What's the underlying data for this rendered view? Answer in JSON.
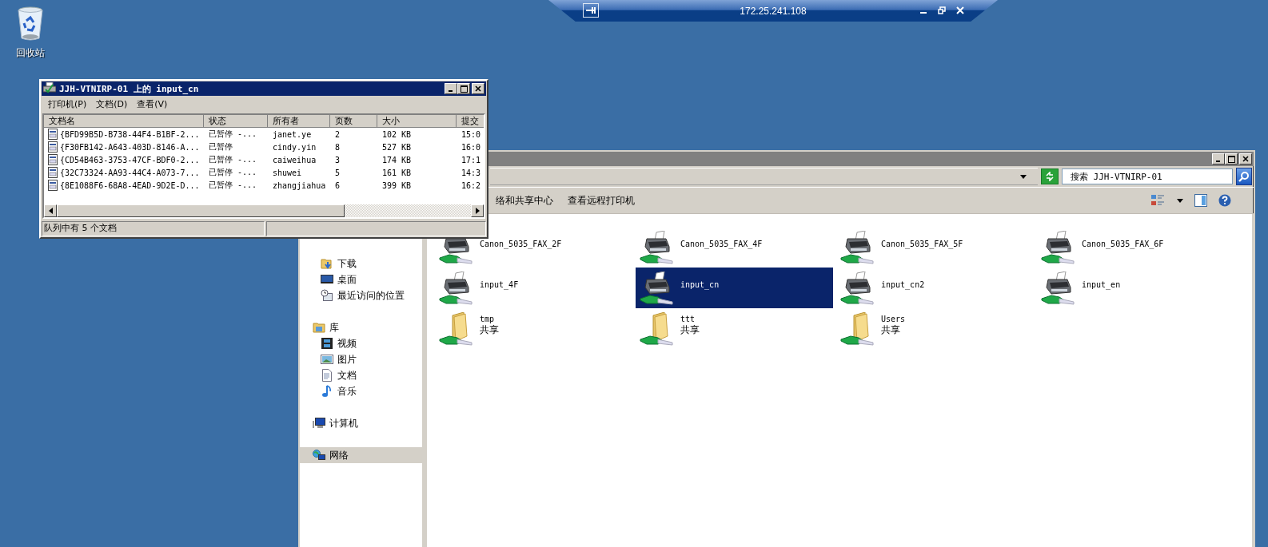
{
  "desktop_icons": [
    {
      "label": "回收站"
    }
  ],
  "connection_bar": {
    "title": "172.25.241.108"
  },
  "explorer": {
    "search": {
      "placeholder": "搜索 JJH-VTNIRP-01"
    },
    "toolbar": [
      "络和共享中心",
      "查看远程打印机"
    ],
    "nav": [
      {
        "kind": "favorites",
        "children": [
          {
            "label": "下载",
            "kind": "download",
            "selected": false
          },
          {
            "label": "桌面",
            "kind": "desktop",
            "selected": false
          },
          {
            "label": "最近访问的位置",
            "kind": "recent",
            "selected": false
          }
        ]
      },
      {
        "kind": "library",
        "label": "库",
        "selected": false,
        "children": [
          {
            "label": "视频",
            "kind": "video",
            "selected": false
          },
          {
            "label": "图片",
            "kind": "picture",
            "selected": false
          },
          {
            "label": "文档",
            "kind": "document",
            "selected": false
          },
          {
            "label": "音乐",
            "kind": "music",
            "selected": false
          }
        ]
      },
      {
        "kind": "computer",
        "label": "计算机",
        "selected": false
      },
      {
        "kind": "network",
        "label": "网络",
        "selected": true
      }
    ],
    "items": [
      {
        "name": "Canon_5035_FAX_2F",
        "kind": "printer",
        "selected": false
      },
      {
        "name": "Canon_5035_FAX_4F",
        "kind": "printer",
        "selected": false
      },
      {
        "name": "Canon_5035_FAX_5F",
        "kind": "printer",
        "selected": false
      },
      {
        "name": "Canon_5035_FAX_6F",
        "kind": "printer",
        "selected": false
      },
      {
        "name": "input_4F",
        "kind": "printer",
        "selected": false
      },
      {
        "name": "input_cn",
        "kind": "printer",
        "selected": true
      },
      {
        "name": "input_cn2",
        "kind": "printer",
        "selected": false
      },
      {
        "name": "input_en",
        "kind": "printer",
        "selected": false
      },
      {
        "name": "tmp",
        "subtitle": "共享",
        "kind": "folder",
        "selected": false
      },
      {
        "name": "ttt",
        "subtitle": "共享",
        "kind": "folder",
        "selected": false
      },
      {
        "name": "Users",
        "subtitle": "共享",
        "kind": "folder",
        "selected": false
      }
    ]
  },
  "queue_window": {
    "title": "JJH-VTNIRP-01 上的 input_cn",
    "menu": [
      "打印机(P)",
      "文档(D)",
      "查看(V)"
    ],
    "columns": [
      "文档名",
      "状态",
      "所有者",
      "页数",
      "大小",
      "提交"
    ],
    "rows": [
      [
        "{BFD99B5D-B738-44F4-B1BF-2...",
        "已暂停 -...",
        "janet.ye",
        "2",
        "102 KB",
        "15:0"
      ],
      [
        "{F30FB142-A643-403D-8146-A...",
        "已暂停",
        "cindy.yin",
        "8",
        "527 KB",
        "16:0"
      ],
      [
        "{CD54B463-3753-47CF-BDF0-2...",
        "已暂停 -...",
        "caiweihua",
        "3",
        "174 KB",
        "17:1"
      ],
      [
        "{32C73324-AA93-44C4-A073-7...",
        "已暂停 -...",
        "shuwei",
        "5",
        "161 KB",
        "14:3"
      ],
      [
        "{8E1088F6-68A8-4EAD-9D2E-D...",
        "已暂停 -...",
        "zhangjiahua",
        "6",
        "399 KB",
        "16:2"
      ]
    ],
    "status": "队列中有 5 个文档"
  }
}
